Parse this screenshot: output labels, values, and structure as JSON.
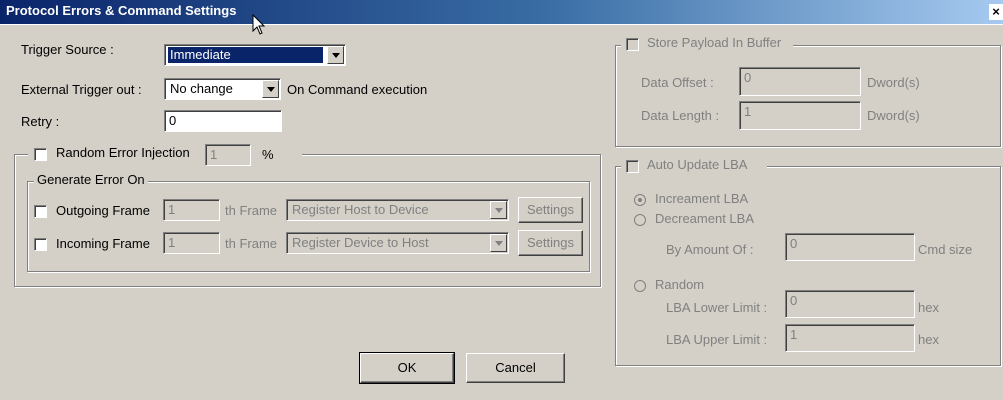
{
  "window": {
    "title": "Protocol Errors & Command Settings",
    "close_label": "×"
  },
  "trigger": {
    "source_label": "Trigger Source :",
    "source_value": "Immediate",
    "ext_out_label": "External Trigger out :",
    "ext_out_value": "No change",
    "ext_out_suffix": "On Command execution",
    "retry_label": "Retry :",
    "retry_value": "0"
  },
  "error_injection": {
    "label": "Random Error Injection",
    "percent_value": "1",
    "percent_unit": "%",
    "generate_legend": "Generate Error On",
    "outgoing": {
      "label": "Outgoing Frame",
      "value": "1",
      "suffix": "th Frame",
      "type": "Register Host to Device",
      "settings": "Settings"
    },
    "incoming": {
      "label": "Incoming Frame",
      "value": "1",
      "suffix": "th Frame",
      "type": "Register Device to Host",
      "settings": "Settings"
    }
  },
  "buffer": {
    "label": "Store Payload In Buffer",
    "offset_label": "Data Offset :",
    "offset_value": "0",
    "offset_unit": "Dword(s)",
    "length_label": "Data Length :",
    "length_value": "1",
    "length_unit": "Dword(s)"
  },
  "lba": {
    "label": "Auto Update LBA",
    "increment": "Increament LBA",
    "decrement": "Decreament LBA",
    "amount_label": "By Amount Of :",
    "amount_value": "0",
    "amount_unit": "Cmd size",
    "random": "Random",
    "lower_label": "LBA Lower Limit :",
    "lower_value": "0",
    "lower_unit": "hex",
    "upper_label": "LBA Upper Limit :",
    "upper_value": "1",
    "upper_unit": "hex"
  },
  "buttons": {
    "ok": "OK",
    "cancel": "Cancel"
  }
}
